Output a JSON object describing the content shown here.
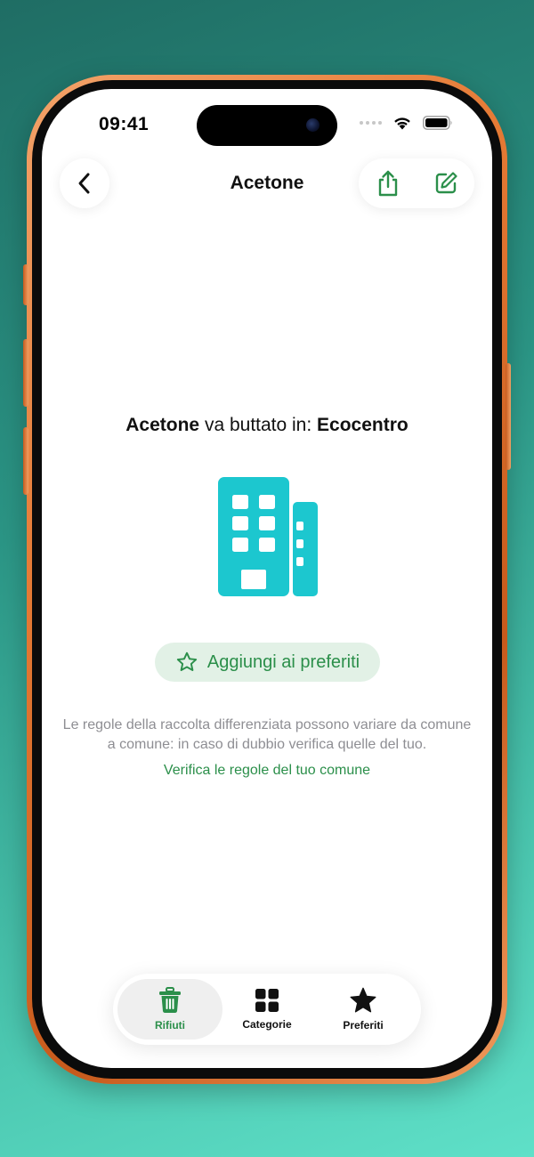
{
  "status_bar": {
    "time": "09:41"
  },
  "nav": {
    "title": "Acetone",
    "back_icon": "chevron-left-icon",
    "share_icon": "share-icon",
    "edit_icon": "compose-icon"
  },
  "main": {
    "item_name": "Acetone",
    "connector_text": "va buttato in:",
    "destination": "Ecocentro",
    "illustration_icon": "building-icon",
    "favorite_label": "Aggiungi ai preferiti",
    "note_text": "Le regole della raccolta differenziata possono variare da comune a comune: in caso di dubbio verifica quelle del tuo.",
    "rules_link": "Verifica le regole del tuo comune"
  },
  "tab_bar": {
    "tabs": [
      {
        "label": "Rifiuti",
        "icon": "trash-icon",
        "active": true
      },
      {
        "label": "Categorie",
        "icon": "grid-icon",
        "active": false
      },
      {
        "label": "Preferiti",
        "icon": "star-icon",
        "active": false
      }
    ]
  },
  "colors": {
    "accent_green": "#2b8f4a",
    "building_teal": "#1cc7cf",
    "favorite_bg": "#e2f1e6",
    "frame_orange": "#e57a35"
  }
}
